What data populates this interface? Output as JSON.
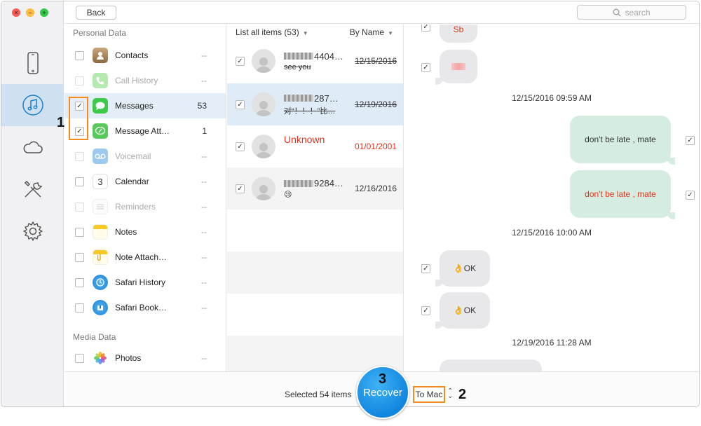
{
  "window": {
    "controls": {
      "close": "×",
      "minimize": "–",
      "zoom": "+"
    }
  },
  "rail": {
    "items": [
      {
        "icon": "iphone-icon",
        "active": false
      },
      {
        "icon": "music-note-icon",
        "active": true
      },
      {
        "icon": "cloud-icon",
        "active": false
      },
      {
        "icon": "tools-icon",
        "active": false
      },
      {
        "icon": "gear-icon",
        "active": false
      }
    ]
  },
  "toolbar": {
    "back_label": "Back",
    "search_placeholder": "search"
  },
  "categories": {
    "personal_title": "Personal Data",
    "media_title": "Media Data",
    "items": [
      {
        "label": "Contacts",
        "count": "--",
        "checked": false,
        "enabled": true,
        "icon": "contacts-icon"
      },
      {
        "label": "Call History",
        "count": "--",
        "checked": false,
        "enabled": false,
        "icon": "phone-icon"
      },
      {
        "label": "Messages",
        "count": "53",
        "checked": true,
        "enabled": true,
        "icon": "messages-icon"
      },
      {
        "label": "Message Att…",
        "count": "1",
        "checked": true,
        "enabled": true,
        "icon": "message-attachments-icon"
      },
      {
        "label": "Voicemail",
        "count": "--",
        "checked": false,
        "enabled": false,
        "icon": "voicemail-icon"
      },
      {
        "label": "Calendar",
        "count": "--",
        "checked": false,
        "enabled": true,
        "icon": "calendar-icon",
        "day": "3"
      },
      {
        "label": "Reminders",
        "count": "--",
        "checked": false,
        "enabled": false,
        "icon": "reminders-icon"
      },
      {
        "label": "Notes",
        "count": "--",
        "checked": false,
        "enabled": true,
        "icon": "notes-icon"
      },
      {
        "label": "Note Attach…",
        "count": "--",
        "checked": false,
        "enabled": true,
        "icon": "note-attachments-icon"
      },
      {
        "label": "Safari History",
        "count": "--",
        "checked": false,
        "enabled": true,
        "icon": "safari-history-icon"
      },
      {
        "label": "Safari Book…",
        "count": "--",
        "checked": false,
        "enabled": true,
        "icon": "safari-bookmarks-icon"
      },
      {
        "label": "Photos",
        "count": "--",
        "checked": false,
        "enabled": true,
        "icon": "photos-icon"
      }
    ]
  },
  "list": {
    "header_left": "List all items (53)",
    "header_right": "By Name",
    "conversations": [
      {
        "name_suffix": "4404…",
        "preview": "see you",
        "date": "12/15/2016",
        "deleted": true,
        "checked": true
      },
      {
        "name_suffix": "287…",
        "preview": "对“！！！”比…",
        "date": "12/19/2016",
        "deleted": true,
        "checked": true
      },
      {
        "name": "Unknown",
        "preview": "",
        "date": "01/01/2001",
        "deleted": false,
        "checked": true
      },
      {
        "name_suffix": "9284…",
        "preview": "😢",
        "date": "12/16/2016",
        "deleted": false,
        "checked": true
      }
    ]
  },
  "detail": {
    "bubble_sb": "Sb",
    "stamp_1": "12/15/2016 09:59 AM",
    "out_1": "don't be late , mate",
    "out_2": "don't be late , mate",
    "stamp_2": "12/15/2016 10:00 AM",
    "in_ok_1": "👌OK",
    "in_ok_2": "👌OK",
    "stamp_3": "12/19/2016 11:28 AM"
  },
  "bottombar": {
    "selected_text": "Selected 54 items",
    "recover_label": "Recover",
    "destination": "To Mac",
    "stepper": "⌃⌄"
  },
  "annotations": {
    "step_1": "1",
    "step_2": "2",
    "step_3": "3"
  },
  "colors": {
    "accent": "#1186df",
    "highlight": "#f58a1f",
    "deleted_red": "#e0341c"
  }
}
